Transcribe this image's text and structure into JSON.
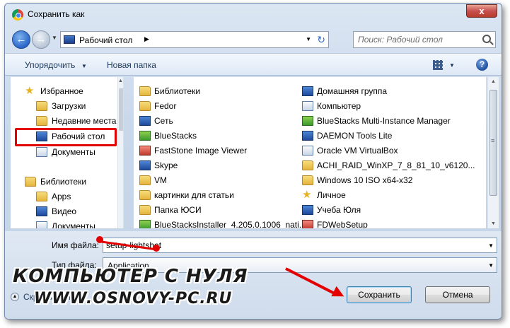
{
  "window": {
    "title": "Сохранить как",
    "close_symbol": "x"
  },
  "address": {
    "path": "Рабочий стол",
    "search_placeholder": "Поиск: Рабочий стол"
  },
  "toolbar": {
    "organize": "Упорядочить",
    "new_folder": "Новая папка",
    "help": "?"
  },
  "nav": {
    "items": [
      {
        "label": "Избранное",
        "icon": "star-icon"
      },
      {
        "label": "Загрузки",
        "icon": "folder-icon"
      },
      {
        "label": "Недавние места",
        "icon": "folder-icon"
      },
      {
        "label": "Рабочий стол",
        "icon": "desktop-icon"
      },
      {
        "label": "Документы",
        "icon": "documents-icon"
      },
      {
        "label": "Библиотеки",
        "icon": "library-icon"
      },
      {
        "label": "Apps",
        "icon": "folder-icon"
      },
      {
        "label": "Видео",
        "icon": "video-icon"
      },
      {
        "label": "Документы",
        "icon": "documents-icon"
      }
    ]
  },
  "files": {
    "left": [
      {
        "label": "Библиотеки",
        "icon": "library-icon"
      },
      {
        "label": "Fedor",
        "icon": "user-folder-icon"
      },
      {
        "label": "Сеть",
        "icon": "network-icon"
      },
      {
        "label": "BlueStacks",
        "icon": "shortcut-icon"
      },
      {
        "label": "FastStone Image Viewer",
        "icon": "shortcut-icon"
      },
      {
        "label": "Skype",
        "icon": "shortcut-icon"
      },
      {
        "label": "VM",
        "icon": "folder-icon"
      },
      {
        "label": "картинки для статьи",
        "icon": "folder-icon"
      },
      {
        "label": "Папка ЮСИ",
        "icon": "folder-icon"
      },
      {
        "label": "BlueStacksInstaller_4.205.0.1006_nati...",
        "icon": "installer-icon"
      }
    ],
    "right": [
      {
        "label": "Домашняя группа",
        "icon": "homegroup-icon"
      },
      {
        "label": "Компьютер",
        "icon": "computer-icon"
      },
      {
        "label": "BlueStacks Multi-Instance Manager",
        "icon": "shortcut-icon"
      },
      {
        "label": "DAEMON Tools Lite",
        "icon": "shortcut-icon"
      },
      {
        "label": "Oracle VM VirtualBox",
        "icon": "shortcut-icon"
      },
      {
        "label": "ACHI_RAID_WinXP_7_8_81_10_v6120...",
        "icon": "folder-icon"
      },
      {
        "label": "Windows 10 ISO x64-x32",
        "icon": "folder-icon"
      },
      {
        "label": "Личное",
        "icon": "star-icon"
      },
      {
        "label": "Учеба Юля",
        "icon": "shortcut-icon"
      },
      {
        "label": "FDWebSetup",
        "icon": "setup-icon"
      }
    ]
  },
  "form": {
    "filename_label": "Имя файла:",
    "filename_value": "setup-lightshot",
    "filetype_label": "Тип файла:",
    "filetype_value": "Application",
    "hide_folders": "Скрыть папки",
    "save": "Сохранить",
    "cancel": "Отмена"
  },
  "watermark": {
    "line1": "КОМПЬЮТЕР С НУЛЯ",
    "line2": "WWW.OSNOVY-PC.RU"
  },
  "colors": {
    "annotation_red": "#e30000",
    "accent_blue": "#1e395b"
  }
}
